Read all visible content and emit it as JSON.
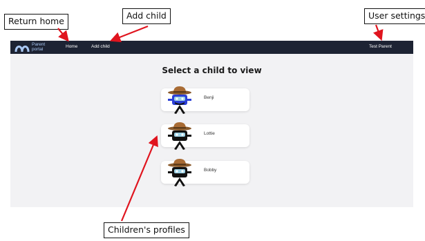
{
  "annotations": {
    "return_home": "Return home",
    "add_child": "Add child",
    "user_settings": "User settings",
    "children_profiles": "Children's profiles"
  },
  "colors": {
    "navbar": "#1d2333",
    "page_background": "#f2f2f4",
    "arrow": "#e0141e",
    "logo": "#a9c7f2"
  },
  "navbar": {
    "logo_icon": "parent-portal-logo",
    "logo_line1": "Parent",
    "logo_line2": "portal",
    "home_label": "Home",
    "add_child_label": "Add child",
    "user_label": "Test Parent"
  },
  "main": {
    "title": "Select a child to view",
    "children": [
      {
        "name": "Benji",
        "avatar_icon": "cowboy-robot-blue-icon",
        "body_color": "#2b3fd6"
      },
      {
        "name": "Lottie",
        "avatar_icon": "cowboy-robot-black-icon",
        "body_color": "#111111"
      },
      {
        "name": "Bobby",
        "avatar_icon": "cowboy-robot-black-icon",
        "body_color": "#111111"
      }
    ]
  }
}
